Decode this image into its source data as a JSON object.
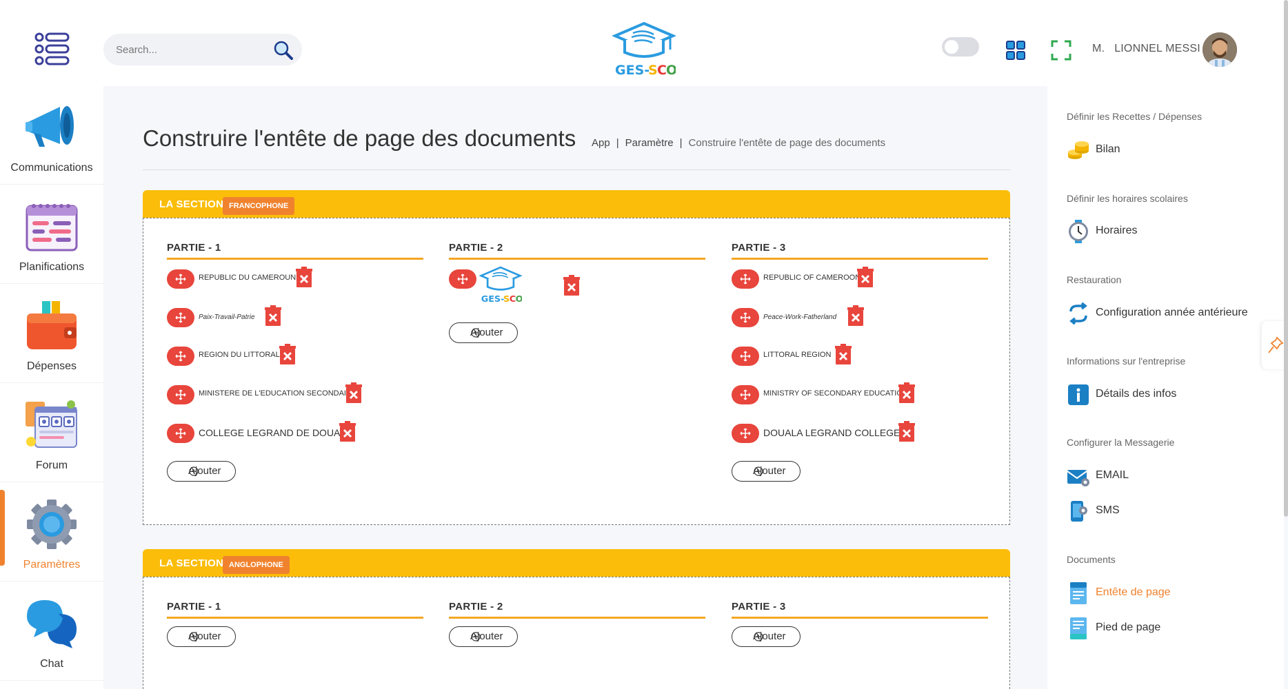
{
  "header": {
    "search_placeholder": "Search...",
    "logo_text": "GES-SCO",
    "user_salutation": "M.",
    "user_name": "LIONNEL MESSI"
  },
  "left_nav": {
    "items": [
      {
        "label": "Communications",
        "icon": "megaphone-icon"
      },
      {
        "label": "Planifications",
        "icon": "calendar-icon"
      },
      {
        "label": "Dépenses",
        "icon": "wallet-icon"
      },
      {
        "label": "Forum",
        "icon": "forum-icon"
      },
      {
        "label": "Paramètres",
        "icon": "gear-icon",
        "active": true
      },
      {
        "label": "Chat",
        "icon": "chat-icon"
      }
    ]
  },
  "page": {
    "title": "Construire l'entête de page des documents",
    "breadcrumb": [
      "App",
      "Paramètre",
      "Construire l'entête de page des documents"
    ]
  },
  "sections": [
    {
      "title": "LA SECTION",
      "badge": "FRANCOPHONE",
      "parties": [
        {
          "title": "PARTIE - 1",
          "entries": [
            "REPUBLIC DU CAMEROUN",
            "Paix-Travail-Patrie",
            "REGION DU LITTORAL",
            "MINISTERE DE L'EDUCATION SECONDAIRE",
            "COLLEGE LEGRAND DE DOUALA"
          ],
          "add_label": "Ajouter"
        },
        {
          "title": "PARTIE - 2",
          "logo_text": "GES-SCO",
          "add_label": "Ajouter"
        },
        {
          "title": "PARTIE - 3",
          "entries": [
            "REPUBLIC OF CAMEROON",
            "Peace-Work-Fatherland",
            "LITTORAL REGION",
            "MINISTRY OF SECONDARY EDUCATION",
            "DOUALA LEGRAND COLLEGE"
          ],
          "add_label": "Ajouter"
        }
      ]
    },
    {
      "title": "LA SECTION",
      "badge": "ANGLOPHONE",
      "parties": [
        {
          "title": "PARTIE - 1",
          "add_label": "Ajouter"
        },
        {
          "title": "PARTIE - 2",
          "add_label": "Ajouter"
        },
        {
          "title": "PARTIE - 3",
          "add_label": "Ajouter"
        }
      ]
    }
  ],
  "right_nav": {
    "groups": [
      {
        "heading": "Définir les Recettes / Dépenses",
        "items": [
          {
            "label": "Bilan",
            "icon": "coins-icon"
          }
        ]
      },
      {
        "heading": "Définir les horaires scolaires",
        "items": [
          {
            "label": "Horaires",
            "icon": "clock-icon"
          }
        ]
      },
      {
        "heading": "Restauration",
        "items": [
          {
            "label": "Configuration année antérieure",
            "icon": "refresh-icon"
          }
        ]
      },
      {
        "heading": "Informations sur l'entreprise",
        "items": [
          {
            "label": "Détails des infos",
            "icon": "info-icon"
          }
        ]
      },
      {
        "heading": "Configurer la Messagerie",
        "items": [
          {
            "label": "EMAIL",
            "icon": "email-icon"
          },
          {
            "label": "SMS",
            "icon": "sms-icon"
          }
        ]
      },
      {
        "heading": "Documents",
        "items": [
          {
            "label": "Entête de page",
            "icon": "document-header-icon",
            "active": true
          },
          {
            "label": "Pied de page",
            "icon": "document-footer-icon"
          }
        ]
      }
    ]
  },
  "colors": {
    "accent": "#f0822e",
    "section_header": "#fbbd0a",
    "move_button": "#e8453c",
    "delete_button": "#e8453c"
  }
}
